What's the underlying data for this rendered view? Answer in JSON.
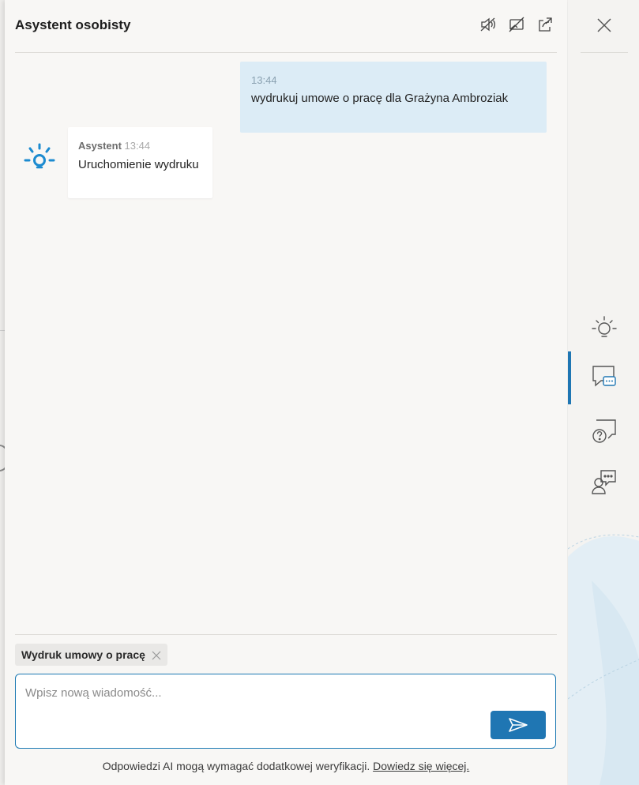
{
  "panel": {
    "title": "Asystent osobisty",
    "header_icons": [
      "mute-speaker-icon",
      "no-video-icon",
      "share-icon"
    ]
  },
  "messages": [
    {
      "role": "user",
      "time": "13:44",
      "text": "wydrukuj umowe o pracę dla Grażyna Ambroziak"
    },
    {
      "role": "assistant",
      "sender": "Asystent",
      "time": "13:44",
      "text": "Uruchomienie wydruku"
    }
  ],
  "context_chip": {
    "label": "Wydruk umowy o pracę"
  },
  "composer": {
    "placeholder": "Wpisz nową wiadomość...",
    "value": ""
  },
  "disclaimer": {
    "text": "Odpowiedzi AI mogą wymagać dodatkowej weryfikacji.",
    "link": "Dowiedz się więcej."
  },
  "rail": {
    "items": [
      "assistant-bulb-icon",
      "chat-icon",
      "help-chat-icon",
      "contact-chat-icon"
    ],
    "active": "chat-icon"
  },
  "colors": {
    "accent": "#1f76b3",
    "user_bubble": "#dcecf6",
    "bot_bubble": "#ffffff"
  }
}
